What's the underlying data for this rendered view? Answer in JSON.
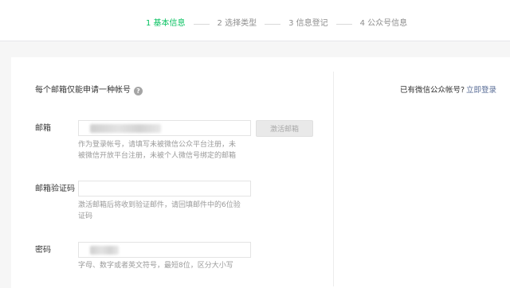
{
  "steps": [
    {
      "label": "1 基本信息",
      "active": true
    },
    {
      "label": "2 选择类型",
      "active": false
    },
    {
      "label": "3 信息登记",
      "active": false
    },
    {
      "label": "4 公众号信息",
      "active": false
    }
  ],
  "form": {
    "title": "每个邮箱仅能申请一种帐号",
    "help_icon": "?",
    "email": {
      "label": "邮箱",
      "hint_line1": "作为登录帐号，请填写未被微信公众平台注册，未",
      "hint_line2": "被微信开放平台注册，未被个人微信号绑定的邮箱",
      "activate_label": "激活邮箱"
    },
    "code": {
      "label": "邮箱验证码",
      "hint_line1": "激活邮箱后将收到验证邮件，请回填邮件中的6位验",
      "hint_line2": "证码"
    },
    "password": {
      "label": "密码",
      "hint": "字母、数字或者英文符号，最短8位，区分大小写"
    }
  },
  "sidebar": {
    "prompt": "已有微信公众帐号?",
    "login_link": "立即登录"
  },
  "colors": {
    "active_step": "#07c160",
    "link": "#576b95"
  }
}
